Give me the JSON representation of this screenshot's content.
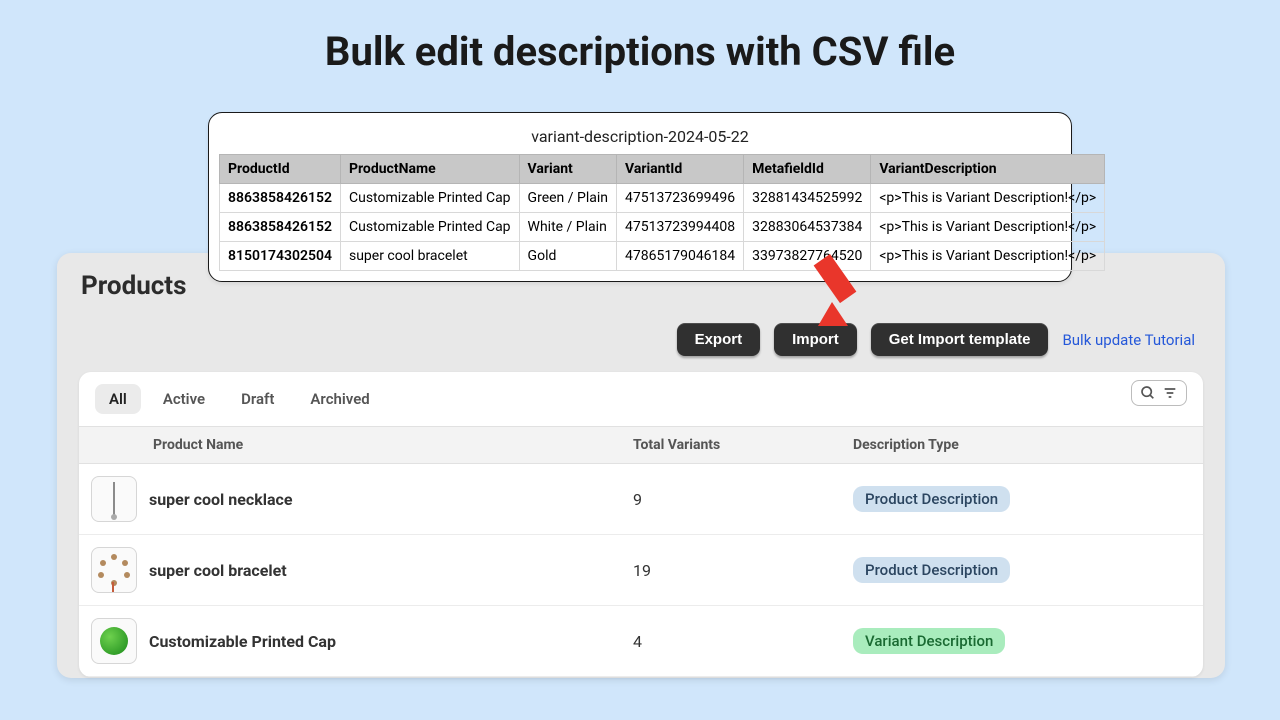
{
  "page": {
    "title": "Bulk edit descriptions with CSV file"
  },
  "csv": {
    "filename": "variant-description-2024-05-22",
    "headers": [
      "ProductId",
      "ProductName",
      "Variant",
      "VariantId",
      "MetafieldId",
      "VariantDescription"
    ],
    "rows": [
      {
        "productId": "8863858426152",
        "productName": "Customizable Printed Cap",
        "variant": "Green / Plain",
        "variantId": "47513723699496",
        "metafieldId": "32881434525992",
        "desc": "<p>This is Variant Description!</p>"
      },
      {
        "productId": "8863858426152",
        "productName": "Customizable Printed Cap",
        "variant": "White / Plain",
        "variantId": "47513723994408",
        "metafieldId": "32883064537384",
        "desc": "<p>This is Variant Description!</p>"
      },
      {
        "productId": "8150174302504",
        "productName": "super cool bracelet",
        "variant": "Gold",
        "variantId": "47865179046184",
        "metafieldId": "33973827764520",
        "desc": "<p>This is Variant Description!</p>"
      }
    ]
  },
  "products": {
    "heading": "Products",
    "buttons": {
      "export": "Export",
      "import": "Import",
      "template": "Get Import template"
    },
    "tutorialLink": "Bulk update Tutorial",
    "tabs": {
      "all": "All",
      "active": "Active",
      "draft": "Draft",
      "archived": "Archived"
    },
    "columns": {
      "name": "Product Name",
      "variants": "Total Variants",
      "descType": "Description Type"
    },
    "rows": [
      {
        "name": "super cool necklace",
        "variants": "9",
        "descType": "Product Description",
        "badgeClass": "blue",
        "thumb": "necklace"
      },
      {
        "name": "super cool bracelet",
        "variants": "19",
        "descType": "Product Description",
        "badgeClass": "blue",
        "thumb": "bracelet"
      },
      {
        "name": "Customizable Printed Cap",
        "variants": "4",
        "descType": "Variant Description",
        "badgeClass": "green",
        "thumb": "cap"
      }
    ]
  },
  "arrow": {
    "color": "#e9362b"
  }
}
